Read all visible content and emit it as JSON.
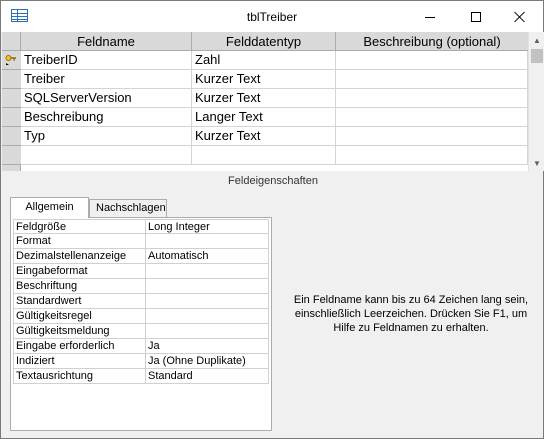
{
  "window": {
    "title": "tblTreiber"
  },
  "grid": {
    "headers": [
      "Feldname",
      "Felddatentyp",
      "Beschreibung (optional)"
    ],
    "rows": [
      {
        "name": "TreiberID",
        "type": "Zahl",
        "desc": "",
        "primary_key": true
      },
      {
        "name": "Treiber",
        "type": "Kurzer Text",
        "desc": ""
      },
      {
        "name": "SQLServerVersion",
        "type": "Kurzer Text",
        "desc": ""
      },
      {
        "name": "Beschreibung",
        "type": "Langer Text",
        "desc": ""
      },
      {
        "name": "Typ",
        "type": "Kurzer Text",
        "desc": ""
      },
      {
        "name": "",
        "type": "",
        "desc": ""
      }
    ]
  },
  "properties": {
    "title": "Feldeigenschaften",
    "tabs": [
      "Allgemein",
      "Nachschlagen"
    ],
    "rows": [
      {
        "name": "Feldgröße",
        "value": "Long Integer"
      },
      {
        "name": "Format",
        "value": ""
      },
      {
        "name": "Dezimalstellenanzeige",
        "value": "Automatisch"
      },
      {
        "name": "Eingabeformat",
        "value": ""
      },
      {
        "name": "Beschriftung",
        "value": ""
      },
      {
        "name": "Standardwert",
        "value": ""
      },
      {
        "name": "Gültigkeitsregel",
        "value": ""
      },
      {
        "name": "Gültigkeitsmeldung",
        "value": ""
      },
      {
        "name": "Eingabe erforderlich",
        "value": "Ja"
      },
      {
        "name": "Indiziert",
        "value": "Ja (Ohne Duplikate)"
      },
      {
        "name": "Textausrichtung",
        "value": "Standard"
      }
    ],
    "help": "Ein Feldname kann bis zu 64 Zeichen lang sein, einschließlich Leerzeichen. Drücken Sie F1, um Hilfe zu Feldnamen zu erhalten."
  },
  "icons": {
    "app": "table-icon",
    "key": "primary-key-icon"
  }
}
